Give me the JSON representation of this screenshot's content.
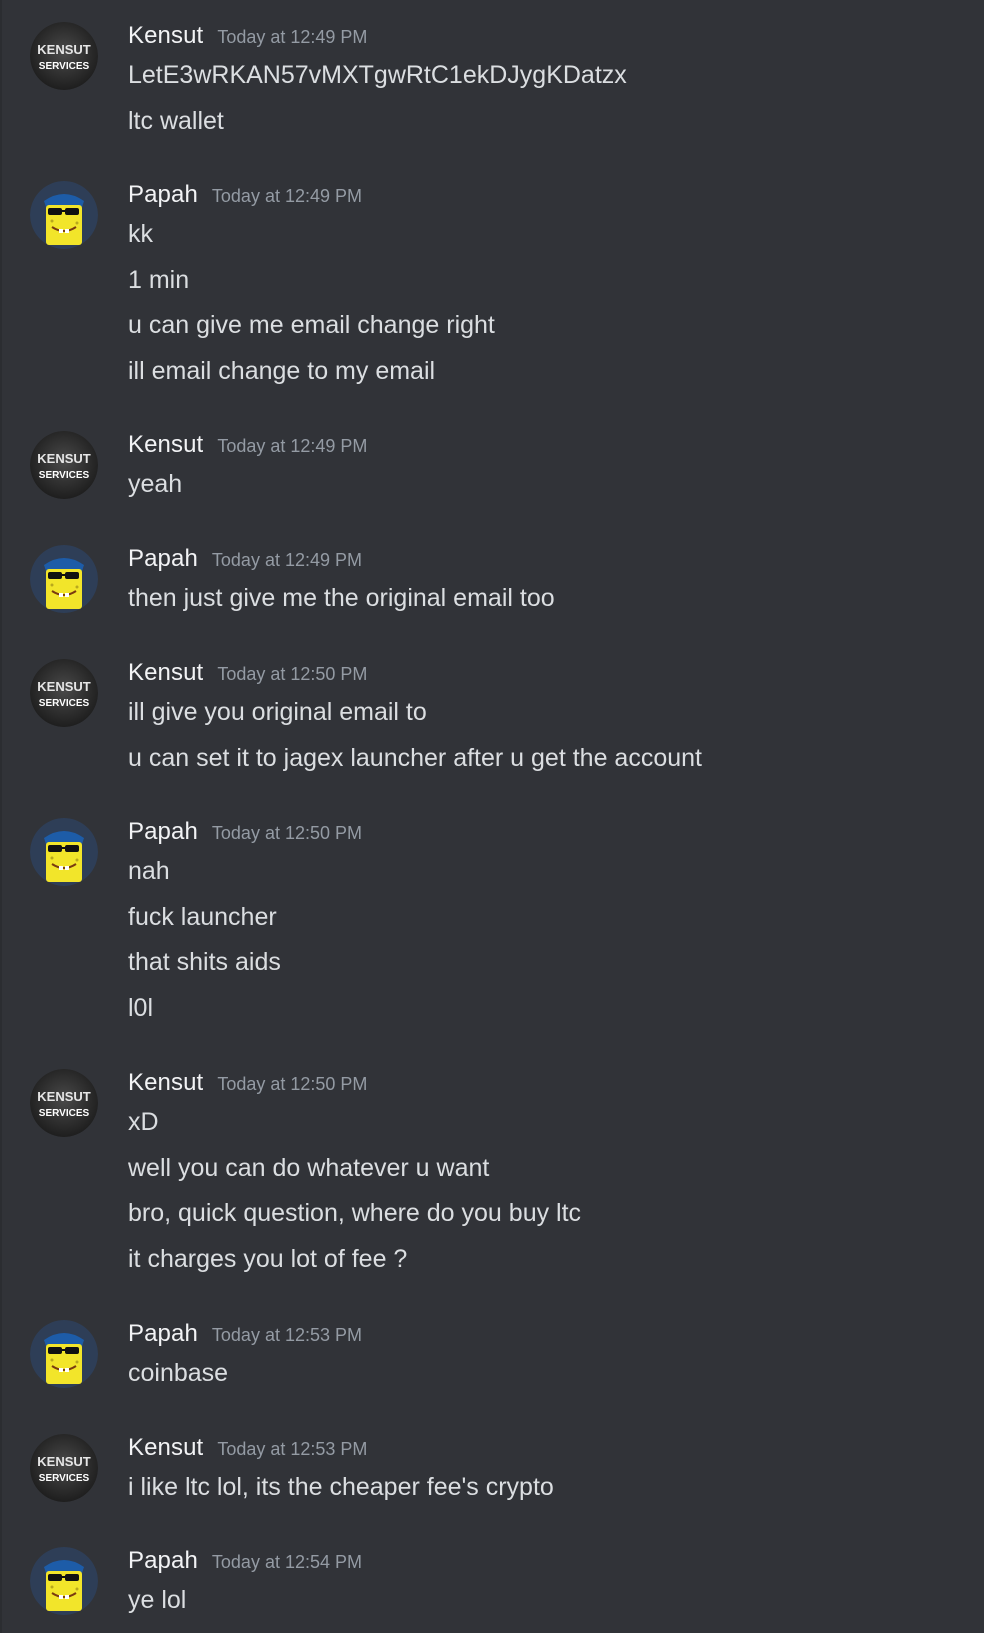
{
  "channel": {
    "messages": [
      {
        "author": "Kensut",
        "avatar": "kensut-services-logo",
        "time": "Today at 12:49 PM",
        "lines": [
          "LetE3wRKAN57vMXTgwRtC1ekDJygKDatzx",
          "ltc wallet"
        ]
      },
      {
        "author": "Papah",
        "avatar": "spongebob-sunglasses",
        "time": "Today at 12:49 PM",
        "lines": [
          "kk",
          "1 min",
          "u can give me email change right",
          "ill email change to my email"
        ]
      },
      {
        "author": "Kensut",
        "avatar": "kensut-services-logo",
        "time": "Today at 12:49 PM",
        "lines": [
          "yeah"
        ]
      },
      {
        "author": "Papah",
        "avatar": "spongebob-sunglasses",
        "time": "Today at 12:49 PM",
        "lines": [
          "then just give me the original email too"
        ]
      },
      {
        "author": "Kensut",
        "avatar": "kensut-services-logo",
        "time": "Today at 12:50 PM",
        "lines": [
          "ill give you original email to",
          "u can set it to jagex launcher after u get the account"
        ]
      },
      {
        "author": "Papah",
        "avatar": "spongebob-sunglasses",
        "time": "Today at 12:50 PM",
        "lines": [
          "nah",
          "fuck launcher",
          "that shits aids",
          "l0l"
        ]
      },
      {
        "author": "Kensut",
        "avatar": "kensut-services-logo",
        "time": "Today at 12:50 PM",
        "lines": [
          "xD",
          "well you can do whatever u want",
          "bro, quick question, where do you buy ltc",
          "it charges you lot of fee ?"
        ]
      },
      {
        "author": "Papah",
        "avatar": "spongebob-sunglasses",
        "time": "Today at 12:53 PM",
        "lines": [
          "coinbase"
        ]
      },
      {
        "author": "Kensut",
        "avatar": "kensut-services-logo",
        "time": "Today at 12:53 PM",
        "lines": [
          "i like ltc lol, its the cheaper fee's crypto"
        ]
      },
      {
        "author": "Papah",
        "avatar": "spongebob-sunglasses",
        "time": "Today at 12:54 PM",
        "lines": [
          "ye lol"
        ]
      }
    ],
    "avatar_text": {
      "kensut_top": "KENSUT",
      "kensut_bottom": "SERVICES"
    }
  },
  "colors": {
    "background": "#313338",
    "username": "#f2f3f5",
    "timestamp": "#949ba4",
    "message_text": "#dbdee1"
  }
}
